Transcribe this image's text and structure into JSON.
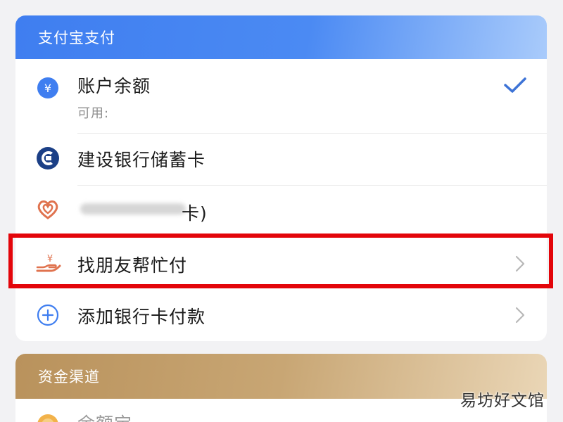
{
  "alipay_section": {
    "header": "支付宝支付",
    "items": [
      {
        "label": "账户余额",
        "sub": "可用:",
        "icon": "yuan-coin-icon",
        "selected": true
      },
      {
        "label": "建设银行储蓄卡",
        "icon": "ccb-logo-icon"
      },
      {
        "label": "卡)",
        "icon": "unionpay-heart-icon",
        "note": "label partially obscured"
      },
      {
        "label": "找朋友帮忙付",
        "icon": "hand-yuan-icon"
      },
      {
        "label": "添加银行卡付款",
        "icon": "plus-circle-icon"
      }
    ],
    "checkmark": "selected-check-icon",
    "chevron": "chevron-right-icon"
  },
  "fund_section": {
    "header": "资金渠道",
    "items": [
      {
        "label": "余额宝",
        "icon": "yuebao-icon"
      }
    ]
  },
  "watermark": "易坊好文馆",
  "colors": {
    "blue_header": "#3f7ef0",
    "gold_header": "#c8a674",
    "highlight": "#e3050a",
    "check": "#3d73d6",
    "ccb_blue": "#1b3f86",
    "orange_icon": "#e0734f"
  }
}
